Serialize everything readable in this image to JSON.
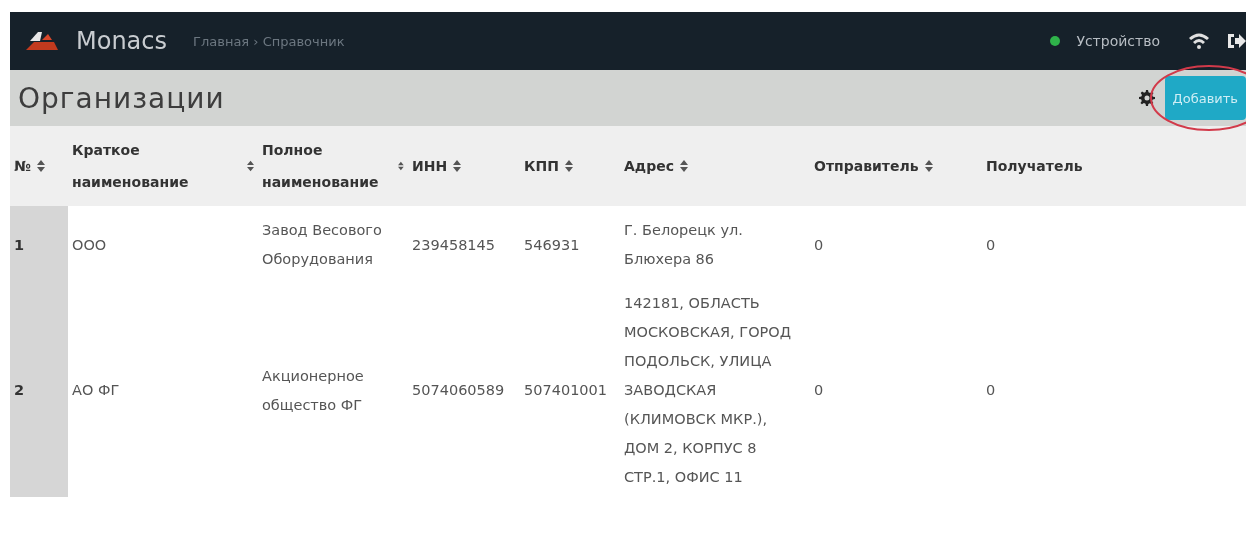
{
  "navbar": {
    "brand": "Monacs",
    "breadcrumb": "Главная › Справочник",
    "device": {
      "label": "Устройство",
      "online": true
    }
  },
  "page": {
    "title": "Организации",
    "add_button": "Добавить"
  },
  "table": {
    "columns": [
      {
        "label": "№"
      },
      {
        "label": "Краткое наименование"
      },
      {
        "label": "Полное наименование"
      },
      {
        "label": "ИНН"
      },
      {
        "label": "КПП"
      },
      {
        "label": "Адрес"
      },
      {
        "label": "Отправитель"
      },
      {
        "label": "Получатель"
      }
    ],
    "rows": [
      {
        "cells": [
          "1",
          "ООО",
          "Завод Весового Оборудования",
          "239458145",
          "546931",
          "Г. Белорецк ул. Блюхера 86",
          "0",
          "0"
        ]
      },
      {
        "cells": [
          "2",
          "АО ФГ",
          "Акционерное общество ФГ",
          "5074060589",
          "507401001",
          "142181, ОБЛАСТЬ МОСКОВСКАЯ, ГОРОД ПОДОЛЬСК, УЛИЦА ЗАВОДСКАЯ (КЛИМОВСК МКР.), ДОМ 2, КОРПУС 8 СТР.1, ОФИС 11",
          "0",
          "0"
        ]
      }
    ]
  }
}
